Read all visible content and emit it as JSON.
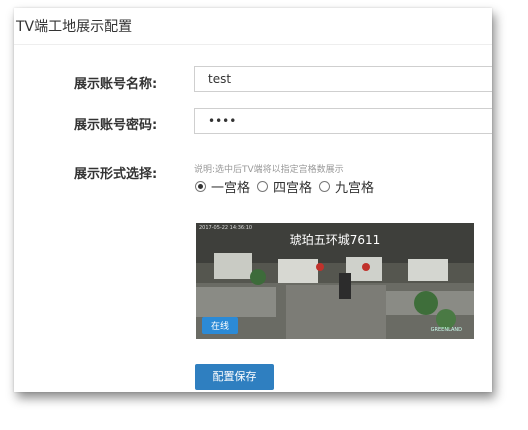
{
  "page_title": "TV端工地展示配置",
  "form": {
    "account_name_label": "展示账号名称:",
    "account_name_value": "test",
    "account_password_label": "展示账号密码:",
    "account_password_value": "••••",
    "display_mode_label": "展示形式选择:",
    "display_mode_hint": "说明:选中后TV端将以指定宫格数展示",
    "display_mode_options": [
      "一宫格",
      "四宫格",
      "九宫格"
    ],
    "display_mode_selected": "一宫格"
  },
  "preview": {
    "camera_title": "琥珀五环城7611",
    "timestamp": "2017-05-22 14:36:10",
    "status_badge": "在线",
    "logo_text": "GREENLAND"
  },
  "save_button_label": "配置保存",
  "colors": {
    "primary": "#2f7fc0",
    "badge": "#2b8ad6"
  }
}
